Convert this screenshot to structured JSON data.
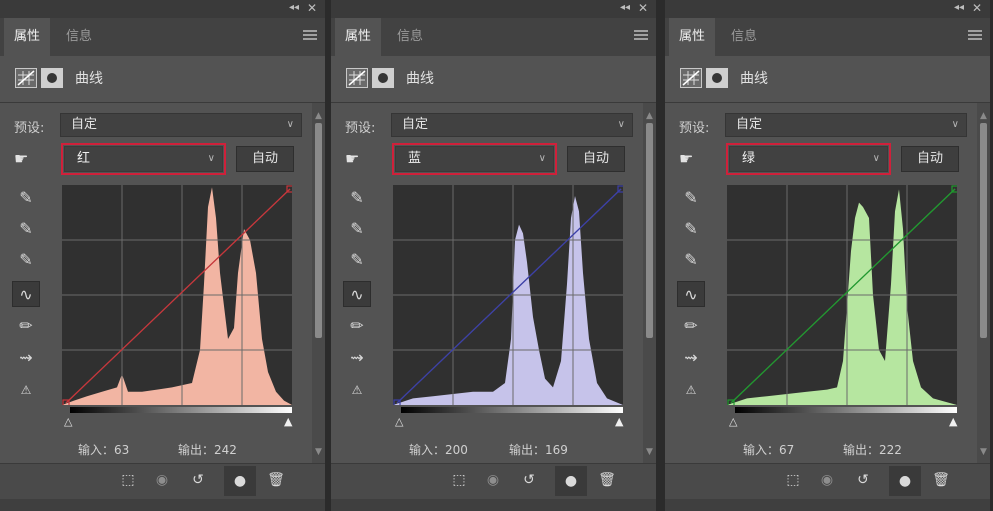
{
  "panels": [
    {
      "tabs": [
        "属性",
        "信息"
      ],
      "header_title": "曲线",
      "preset_label": "预设:",
      "preset_value": "自定",
      "channel": "红",
      "auto_label": "自动",
      "input_label": "输入：",
      "input_value": "63",
      "output_label": "输出：",
      "output_value": "242",
      "curve_color": "#c8353a",
      "hist_color": "#f2b5a3"
    },
    {
      "tabs": [
        "属性",
        "信息"
      ],
      "header_title": "曲线",
      "preset_label": "预设:",
      "preset_value": "自定",
      "channel": "蓝",
      "auto_label": "自动",
      "input_label": "输入：",
      "input_value": "200",
      "output_label": "输出：",
      "output_value": "169",
      "curve_color": "#3b3fa8",
      "hist_color": "#c6c3ea"
    },
    {
      "tabs": [
        "属性",
        "信息"
      ],
      "header_title": "曲线",
      "preset_label": "预设:",
      "preset_value": "自定",
      "channel": "绿",
      "auto_label": "自动",
      "input_label": "输入：",
      "input_value": "67",
      "output_label": "输出：",
      "output_value": "222",
      "curve_color": "#1f9a2e",
      "hist_color": "#b6e6a0"
    }
  ]
}
